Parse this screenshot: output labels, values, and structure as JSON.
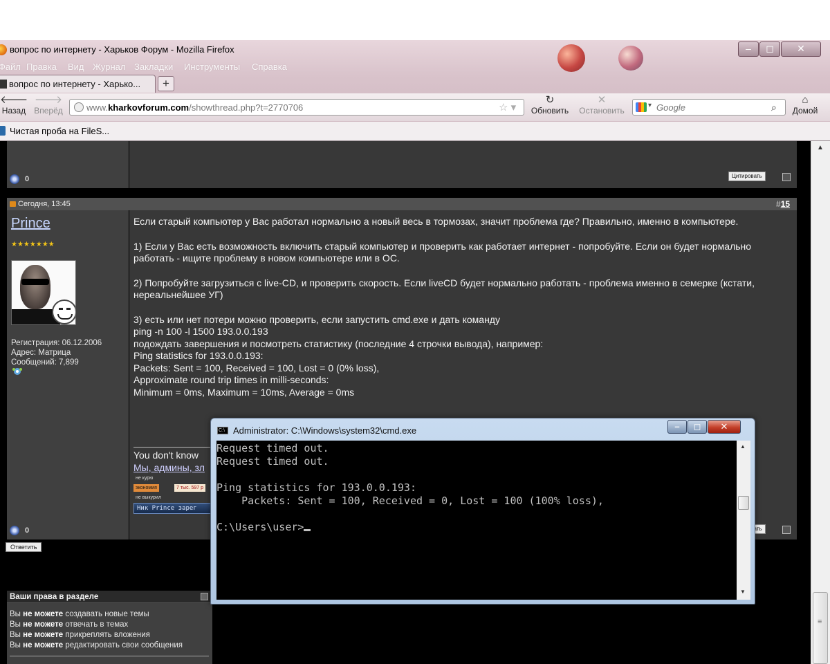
{
  "browser": {
    "window_title": "вопрос по интернету - Харьков Форум - Mozilla Firefox",
    "menu": [
      "Файл",
      "Правка",
      "Вид",
      "Журнал",
      "Закладки",
      "Инструменты",
      "Справка"
    ],
    "tab_title": "вопрос по интернету - Харько...",
    "new_tab": "+",
    "back_label": "Назад",
    "forward_label": "Вперёд",
    "reload_label": "Обновить",
    "stop_label": "Остановить",
    "home_label": "Домой",
    "url_prefix": "www.",
    "url_domain": "kharkovforum.com",
    "url_path": "/showthread.php?t=2770706",
    "search_placeholder": "Google",
    "bookmark": "Чистая проба на FileS..."
  },
  "prev_post": {
    "reputation": "0",
    "quote_label": "Цитировать"
  },
  "post": {
    "date": "Сегодня, 13:45",
    "number_prefix": "#",
    "number": "15",
    "username": "Prince",
    "stars": "★★★★★★★",
    "registration": "Регистрация: 06.12.2006",
    "address": "Адрес: Матрица",
    "messages": "Сообщений: 7,899",
    "reputation": "0",
    "quote_label": "Цитировать",
    "body": [
      "Если старый компьютер у Вас работал нормально а новый весь в тормозах, значит проблема где? Правильно, именно в компьютере.",
      "1) Если у Вас есть возможность включить старый компьютер и проверить как работает интернет - попробуйте. Если он будет нормально работать - ищите проблему в новом компьютере или в ОС.",
      "2) Попробуйте загрузиться с live-CD, и проверить скорость. Если liveCD будет нормально работать - проблема именно в семерке (кстати, нереальнейшее УГ)",
      "3) есть или нет потери можно проверить, если запустить cmd.exe и дать команду",
      "ping -n 100 -l 1500 193.0.0.193",
      "подождать завершения и посмотреть статистику (последние 4 строчки вывода), например:",
      "Ping statistics for 193.0.0.193:",
      "Packets: Sent = 100, Received = 100, Lost = 0 (0% loss),",
      "Approximate round trip times in milli-seconds:",
      "Minimum = 0ms, Maximum = 10ms, Average = 0ms"
    ],
    "signature_line1": "You don't know",
    "signature_line2": "Мы, админы, зл",
    "sig_badges": [
      "не курю",
      "экономия",
      "7 тыс. 597 р",
      "не выкурил"
    ],
    "nick_badge": "Ник Prince зарег"
  },
  "reply_label": "Ответить",
  "rights": {
    "title": "Ваши права в разделе",
    "lines": [
      {
        "pre": "Вы ",
        "strong": "не можете",
        "post": " создавать новые темы"
      },
      {
        "pre": "Вы ",
        "strong": "не можете",
        "post": " отвечать в темах"
      },
      {
        "pre": "Вы ",
        "strong": "не можете",
        "post": " прикреплять вложения"
      },
      {
        "pre": "Вы ",
        "strong": "не можете",
        "post": " редактировать свои сообщения"
      }
    ]
  },
  "cmd": {
    "title": "Administrator: C:\\Windows\\system32\\cmd.exe",
    "lines": [
      "Request timed out.",
      "Request timed out.",
      "",
      "Ping statistics for 193.0.0.193:",
      "    Packets: Sent = 100, Received = 0, Lost = 100 (100% loss),",
      "",
      "C:\\Users\\user>"
    ]
  },
  "colors": {
    "page_bg": "#000000",
    "post_bg": "#383838",
    "userinfo_bg": "#404040",
    "username": "#c9d8ff",
    "stars": "#f2c418",
    "cmd_text": "#c0c0c0"
  }
}
